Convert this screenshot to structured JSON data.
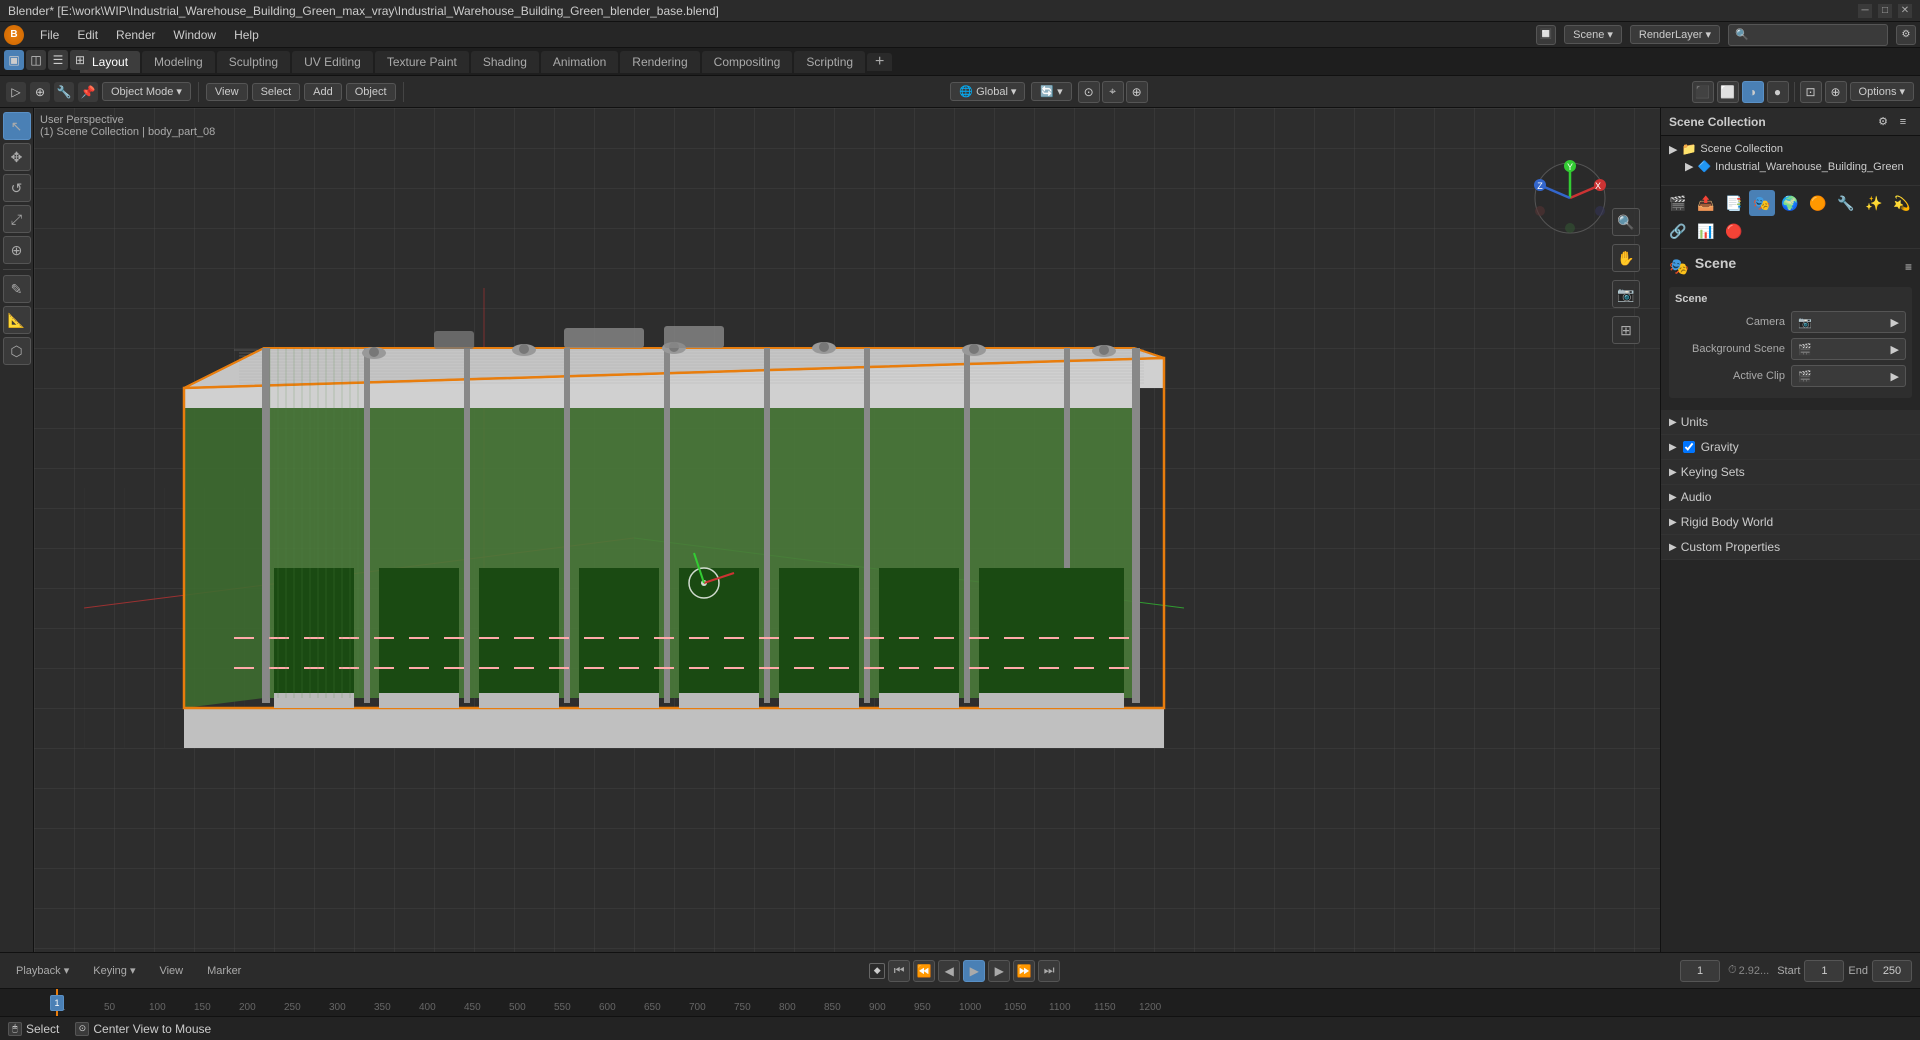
{
  "window": {
    "title": "Blender* [E:\\work\\WIP\\Industrial_Warehouse_Building_Green_max_vray\\Industrial_Warehouse_Building_Green_blender_base.blend]"
  },
  "menu": {
    "items": [
      "File",
      "Edit",
      "Render",
      "Window",
      "Help"
    ]
  },
  "workspace_tabs": {
    "tabs": [
      "Layout",
      "Modeling",
      "Sculpting",
      "UV Editing",
      "Texture Paint",
      "Shading",
      "Animation",
      "Rendering",
      "Compositing",
      "Scripting",
      "+"
    ],
    "active": "Layout"
  },
  "header": {
    "mode": "Object Mode",
    "view": "View",
    "select": "Select",
    "add": "Add",
    "object": "Object",
    "global": "Global",
    "options": "Options",
    "renderlayer": "RenderLayer",
    "scene": "Scene"
  },
  "viewport": {
    "perspective": "User Perspective",
    "collection": "(1) Scene Collection | body_part_08"
  },
  "left_tools": {
    "tools": [
      "↖",
      "✥",
      "↺",
      "⤢",
      "✎",
      "📐",
      "⬡"
    ]
  },
  "right_panel": {
    "header": "Scene Collection",
    "tree_item": "Industrial_Warehouse_Building_Green",
    "scene_label": "Scene",
    "sub_scene_label": "Scene",
    "camera_label": "Camera",
    "bg_scene_label": "Background Scene",
    "active_clip_label": "Active Clip",
    "sections": [
      {
        "name": "Units",
        "expanded": false
      },
      {
        "name": "Gravity",
        "expanded": false,
        "checkbox": true
      },
      {
        "name": "Keying Sets",
        "expanded": false
      },
      {
        "name": "Audio",
        "expanded": false
      },
      {
        "name": "Rigid Body World",
        "expanded": false
      },
      {
        "name": "Custom Properties",
        "expanded": false
      }
    ]
  },
  "timeline": {
    "playback": "Playback",
    "keying": "Keying",
    "view": "View",
    "marker": "Marker",
    "frame_current": "1",
    "start_label": "Start",
    "start_value": "1",
    "end_label": "End",
    "end_value": "250",
    "frame_display": "2.92...",
    "ruler_marks": [
      "1",
      "50",
      "100",
      "150",
      "200",
      "250"
    ],
    "ruler_positions": [
      0,
      45,
      90,
      136,
      181,
      226
    ]
  },
  "status_bar": {
    "left": "Select",
    "center": "Center View to Mouse"
  },
  "gizmo": {
    "x_label": "X",
    "y_label": "Y",
    "z_label": "Z"
  },
  "icons": {
    "move": "✥",
    "rotate": "↺",
    "scale": "⤢",
    "camera": "📷",
    "scene": "🎬",
    "render": "🖼",
    "output": "📤",
    "view_layer": "📑",
    "scene_props": "🎭",
    "world": "🌍",
    "object": "🟠",
    "modifier": "🔧",
    "particles": "✨",
    "physics": "💫",
    "constraints": "🔗",
    "data": "📊",
    "material": "🔴",
    "shading": "🔵"
  }
}
